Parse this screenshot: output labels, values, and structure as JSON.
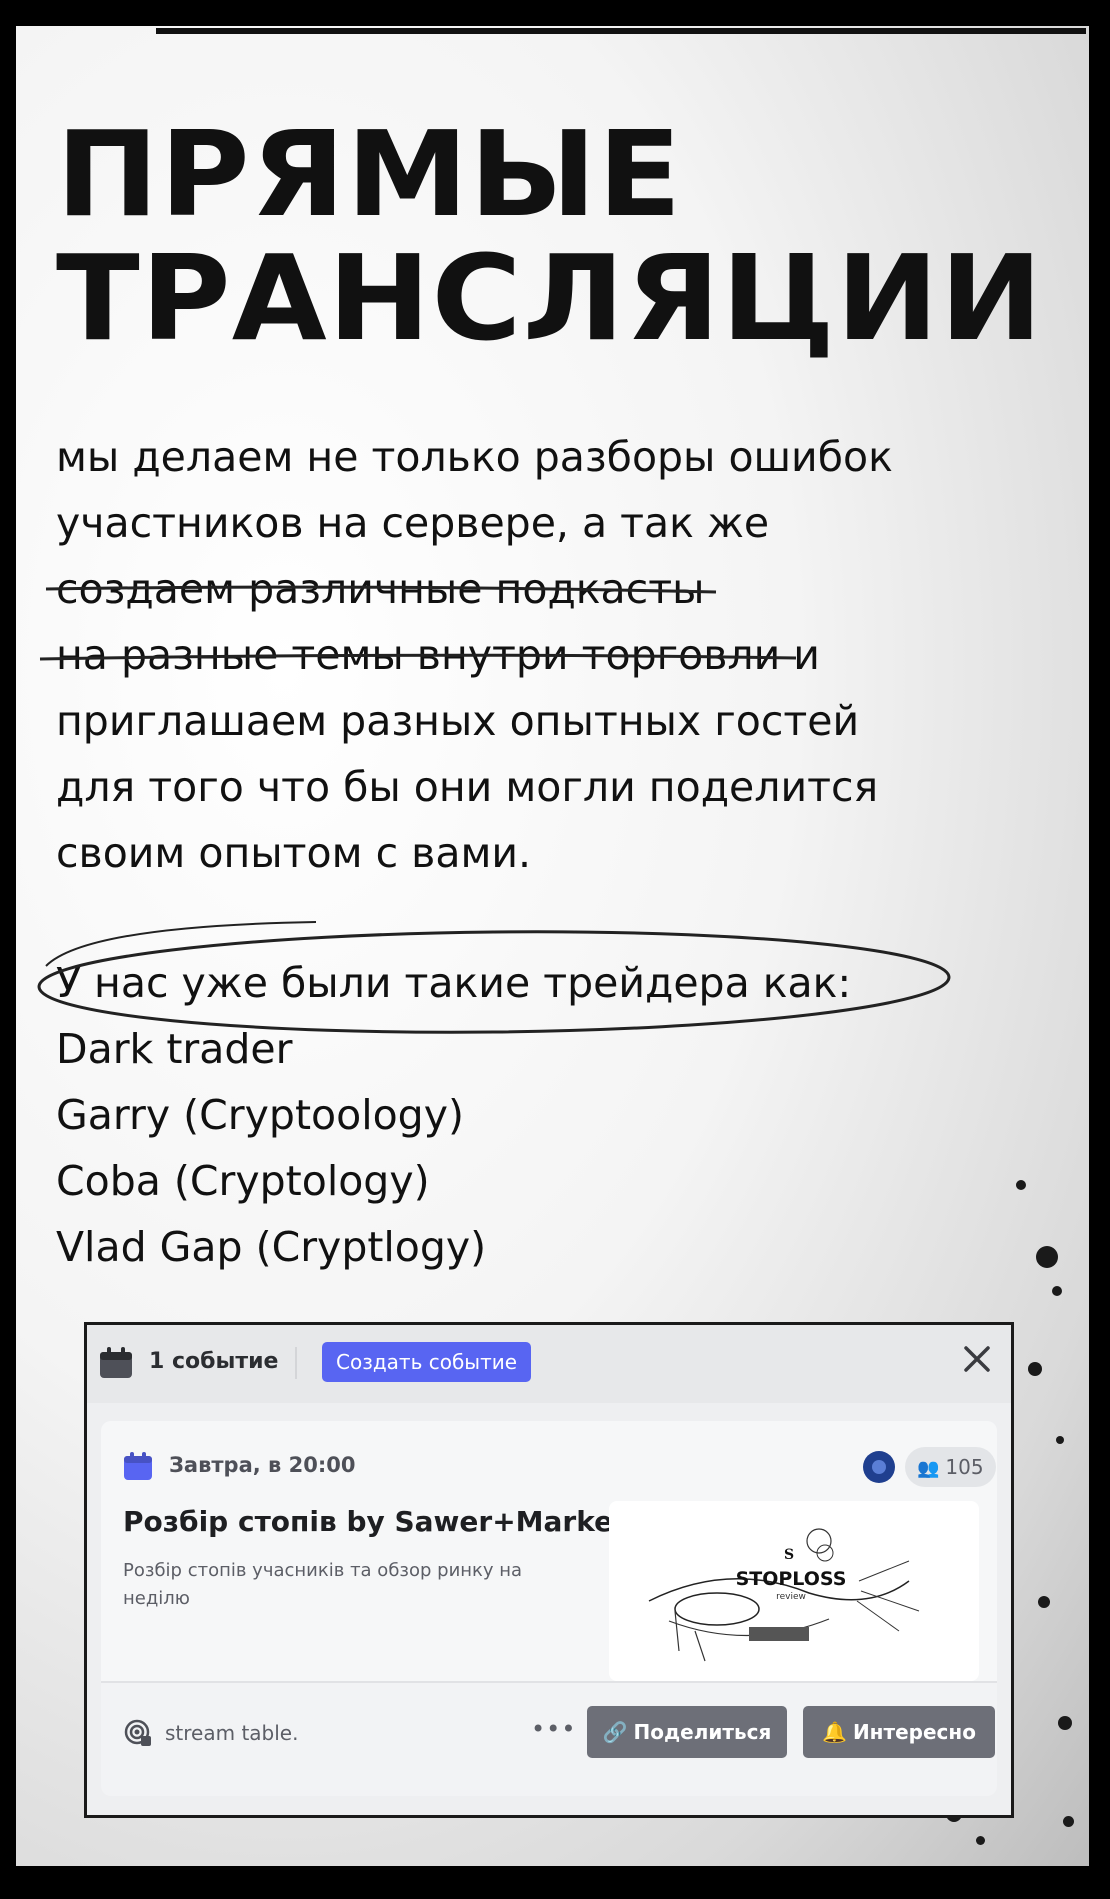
{
  "title": {
    "line1": "ПРЯМЫЕ",
    "line2": "ТРАНСЛЯЦИИ"
  },
  "intro": {
    "lines": [
      "мы делаем не только разборы ошибок",
      "участников на сервере, а так же",
      "создаем различные подкасты",
      "на разные темы внутри торговли и",
      "приглашаем разных опытных гостей",
      "для того что бы они могли поделится",
      "своим  опытом с вами."
    ]
  },
  "traders": {
    "heading": "У нас уже были такие трейдера как:",
    "names": [
      "Dark trader",
      "Garry (Cryptoology)",
      "Coba (Cryptology)",
      "Vlad Gap (Cryptlogy)"
    ]
  },
  "event_window": {
    "count_label": "1 событие",
    "create_button": "Создать событие",
    "icons": {
      "calendar": "calendar-icon",
      "close": "close-icon"
    },
    "event": {
      "date": "Завтра, в 20:00",
      "attendees": "105",
      "name": "Розбір стопів by Sawer+Market...",
      "description": "Розбір стопів учасників та обзор ринку на неділю",
      "cover_brand": "STOPLOSS",
      "cover_sub": "review",
      "cover_mark": "S",
      "channel": "stream table.",
      "more": "•••",
      "share_button": "Поделиться",
      "interest_button": "Интересно"
    },
    "colors": {
      "accent": "#5865f2",
      "button_gray": "#6d6f78"
    }
  }
}
